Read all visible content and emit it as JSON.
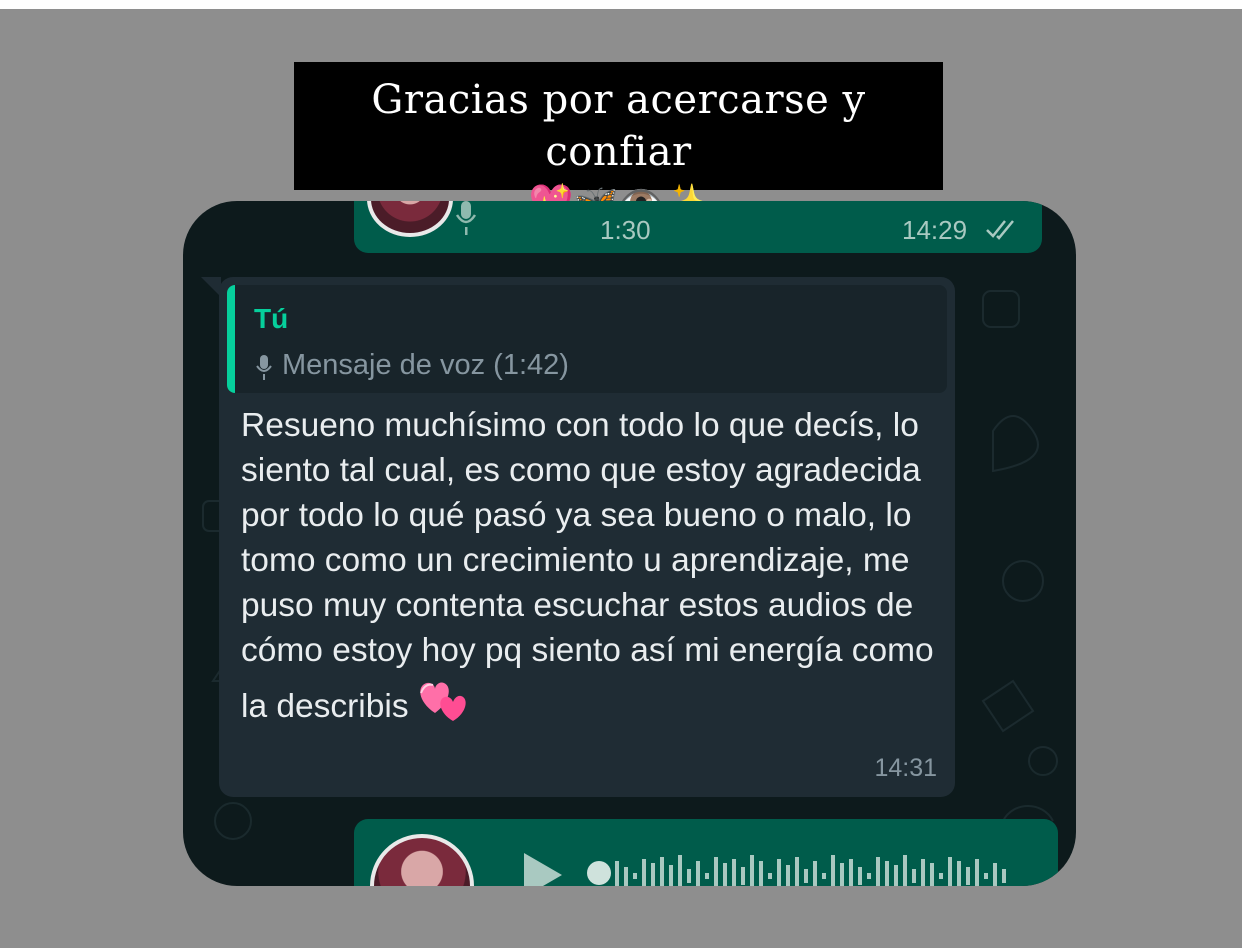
{
  "caption": {
    "line1": "Gracias por acercarse y confiar",
    "line2": "💖🦋👁️✨"
  },
  "chat": {
    "prev_voice": {
      "duration": "1:30",
      "time": "14:29",
      "status_icon": "double-check-icon"
    },
    "incoming": {
      "quoted_author": "Tú",
      "quoted_text": "Mensaje de voz (1:42)",
      "text": "Resueno muchísimo con todo lo que decís, lo siento tal cual, es como que estoy agradecida por todo lo qué pasó ya sea bueno o malo, lo tomo como un crecimiento u aprendizaje, me puso muy contenta escuchar estos audios de cómo estoy hoy pq siento así mi energía como la describis",
      "emoji": "💞",
      "time": "14:31"
    },
    "next_voice": {
      "play_icon": "play-icon"
    }
  },
  "colors": {
    "outgoing_bubble": "#005c4b",
    "incoming_bubble": "#1f2c34",
    "accent": "#06cf9c",
    "background": "#0d1a1c"
  }
}
